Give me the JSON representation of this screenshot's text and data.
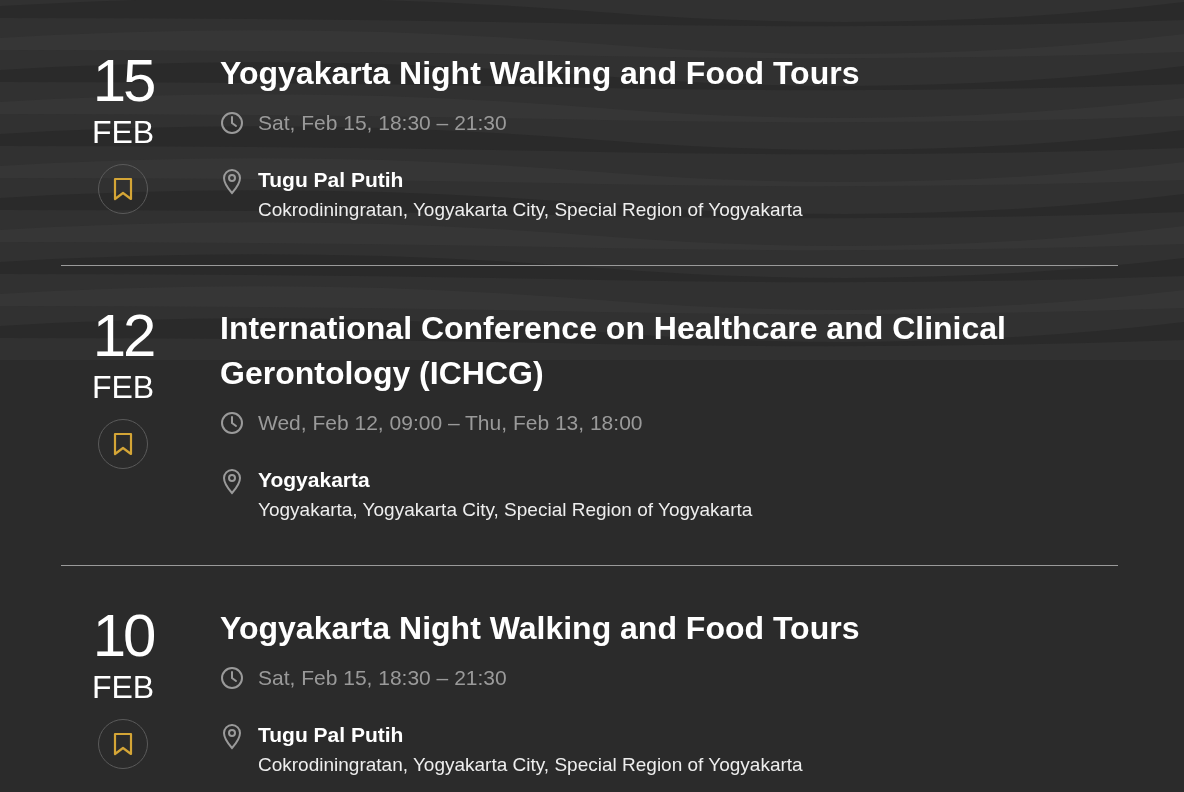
{
  "events": [
    {
      "day": "15",
      "month": "FEB",
      "title": "Yogyakarta Night Walking and Food Tours",
      "time": "Sat, Feb 15, 18:30 – 21:30",
      "venue": "Tugu Pal Putih",
      "address": "Cokrodiningratan, Yogyakarta City, Special Region of Yogyakarta"
    },
    {
      "day": "12",
      "month": "FEB",
      "title": "International Conference on Healthcare and Clinical Gerontology (ICHCG)",
      "time": "Wed, Feb 12, 09:00 – Thu, Feb 13, 18:00",
      "venue": "Yogyakarta",
      "address": "Yogyakarta, Yogyakarta City, Special Region of Yogyakarta"
    },
    {
      "day": "10",
      "month": "FEB",
      "title": "Yogyakarta Night Walking and Food Tours",
      "time": "Sat, Feb 15, 18:30 – 21:30",
      "venue": "Tugu Pal Putih",
      "address": "Cokrodiningratan, Yogyakarta City, Special Region of Yogyakarta"
    }
  ]
}
